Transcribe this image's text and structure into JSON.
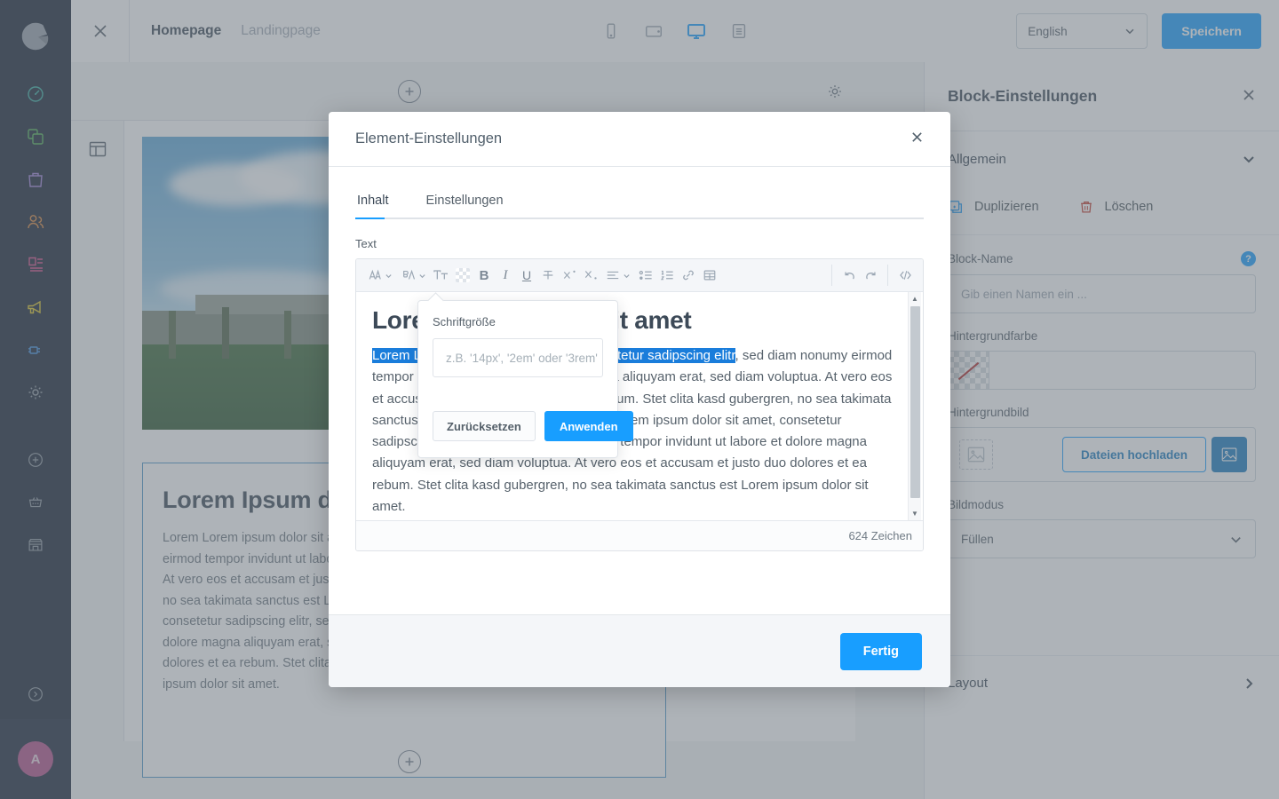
{
  "nav": {
    "logo_name": "shopware-logo",
    "items": [
      {
        "name": "dashboard",
        "icon": "gauge-icon",
        "color": "#37ada0"
      },
      {
        "name": "catalogue",
        "icon": "copy-icon",
        "color": "#4eb053"
      },
      {
        "name": "orders",
        "icon": "bag-icon",
        "color": "#9b7fd4"
      },
      {
        "name": "customers",
        "icon": "users-icon",
        "color": "#d9853b"
      },
      {
        "name": "content",
        "icon": "content-icon",
        "color": "#d24a87"
      },
      {
        "name": "marketing",
        "icon": "megaphone-icon",
        "color": "#d9c024"
      },
      {
        "name": "extensions",
        "icon": "plug-icon",
        "color": "#3e8ede"
      },
      {
        "name": "settings",
        "icon": "gear-icon",
        "color": "#8d97a1"
      }
    ],
    "bottom_items": [
      {
        "name": "add",
        "icon": "plus-circle-icon"
      },
      {
        "name": "basket",
        "icon": "basket-icon"
      },
      {
        "name": "store",
        "icon": "store-icon"
      }
    ],
    "expand_icon": "chevron-right-circle-icon",
    "avatar_initial": "A"
  },
  "topbar": {
    "close_icon": "close-icon",
    "pages": [
      {
        "label": "Homepage",
        "active": true
      },
      {
        "label": "Landingpage",
        "active": false
      }
    ],
    "devices": [
      {
        "name": "mobile",
        "icon": "mobile-icon",
        "active": false
      },
      {
        "name": "tablet",
        "icon": "tablet-icon",
        "active": false
      },
      {
        "name": "desktop",
        "icon": "desktop-icon",
        "active": true
      },
      {
        "name": "list-view",
        "icon": "list-icon",
        "active": false
      }
    ],
    "language": "English",
    "save_label": "Speichern",
    "accent": "#189eff"
  },
  "canvas": {
    "add_section_label": "+",
    "gear_icon": "gear-icon",
    "layout_icon": "layout-icon",
    "text_block": {
      "heading": "Lorem Ipsum dolor sit amet",
      "paragraph": "Lorem Lorem ipsum dolor sit amet, consetetur sadipscing elitr, sed diam nonumy eirmod tempor invidunt ut labore et dolore magna aliquyam erat, sed diam voluptua. At vero eos et accusam et justo duo dolores et ea rebum. Stet clita kasd gubergren, no sea takimata sanctus est Lorem ipsum dolor sit amet. Lorem ipsum dolor sit amet, consetetur sadipscing elitr, sed diam nonumy eirmod tempor invidunt ut labore et dolore magna aliquyam erat, sed diam voluptua. At vero eos et accusam et justo duo dolores et ea rebum. Stet clita kasd gubergren, no sea takimata sanctus est Lorem ipsum dolor sit amet."
    }
  },
  "side_panel": {
    "title": "Block-Einstellungen",
    "close_icon": "close-icon",
    "sections": {
      "general": {
        "title": "Allgemein",
        "chevron": "chevron-down-icon"
      },
      "layout": {
        "title": "Layout",
        "chevron": "chevron-right-icon"
      }
    },
    "actions": {
      "duplicate": {
        "label": "Duplizieren",
        "icon": "duplicate-icon",
        "color": "#189eff"
      },
      "delete": {
        "label": "Löschen",
        "icon": "trash-icon",
        "color": "#c0392b"
      }
    },
    "fields": {
      "block_name": {
        "label": "Block-Name",
        "placeholder": "Gib einen Namen ein ...",
        "value": "",
        "help_icon": "question-icon"
      },
      "background_color": {
        "label": "Hintergrundfarbe",
        "value": "",
        "swatch": "transparent-swatch"
      },
      "background_image": {
        "label": "Hintergrundbild",
        "upload_label": "Dateien hochladen",
        "media_icon": "image-icon",
        "open_media_icon": "image-icon"
      },
      "image_mode": {
        "label": "Bildmodus",
        "value": "Füllen",
        "chevron": "chevron-down-icon"
      }
    }
  },
  "modal": {
    "title": "Element-Einstellungen",
    "close_icon": "close-icon",
    "tabs": [
      {
        "label": "Inhalt",
        "active": true
      },
      {
        "label": "Einstellungen",
        "active": false
      }
    ],
    "text_field_label": "Text",
    "toolbar": [
      {
        "name": "text-color",
        "glyph": "A",
        "dropdown": true
      },
      {
        "name": "background-color",
        "glyph": "A",
        "dropdown": true
      },
      {
        "name": "font-size",
        "glyph": "Tt",
        "dropdown": false
      },
      {
        "name": "color-swatch",
        "glyph": "",
        "dropdown": false
      },
      {
        "name": "bold",
        "glyph": "B",
        "dropdown": false
      },
      {
        "name": "italic",
        "glyph": "I",
        "dropdown": false
      },
      {
        "name": "underline",
        "glyph": "U",
        "dropdown": false
      },
      {
        "name": "strikethrough",
        "glyph": "T",
        "dropdown": false
      },
      {
        "name": "superscript",
        "glyph": "X",
        "dropdown": false
      },
      {
        "name": "subscript",
        "glyph": "X",
        "dropdown": false
      },
      {
        "name": "align",
        "glyph": "",
        "dropdown": true
      },
      {
        "name": "bullet-list",
        "glyph": "",
        "dropdown": false
      },
      {
        "name": "ordered-list",
        "glyph": "",
        "dropdown": false
      },
      {
        "name": "link",
        "glyph": "",
        "dropdown": false
      },
      {
        "name": "table",
        "glyph": "",
        "dropdown": false
      },
      {
        "name": "undo",
        "glyph": "",
        "dropdown": false
      },
      {
        "name": "redo",
        "glyph": "",
        "dropdown": false
      },
      {
        "name": "source-code",
        "glyph": "",
        "dropdown": false
      }
    ],
    "editor": {
      "heading": "Lorem ipsum dolor sit amet",
      "selected_text": "Lorem Lorem ipsum dolor sit amet, consetetur sadipscing elitr",
      "paragraph_rest": ", sed diam nonumy eirmod tempor invidunt ut labore et dolore magna aliquyam erat, sed diam voluptua. At vero eos et accusam et justo duo dolores et ea rebum. Stet clita kasd gubergren, no sea takimata sanctus est Lorem ipsum dolor sit amet. Lorem ipsum dolor sit amet, consetetur sadipscing elitr, sed diam nonumy eirmod tempor invidunt ut labore et dolore magna aliquyam erat, sed diam voluptua. At vero eos et accusam et justo duo dolores et ea rebum. Stet clita kasd gubergren, no sea takimata sanctus est Lorem ipsum dolor sit amet.",
      "char_count": "624 Zeichen"
    },
    "done_label": "Fertig"
  },
  "popover": {
    "label": "Schriftgröße",
    "placeholder": "z.B. '14px', '2em' oder '3rem'",
    "value": "",
    "reset_label": "Zurücksetzen",
    "apply_label": "Anwenden"
  }
}
